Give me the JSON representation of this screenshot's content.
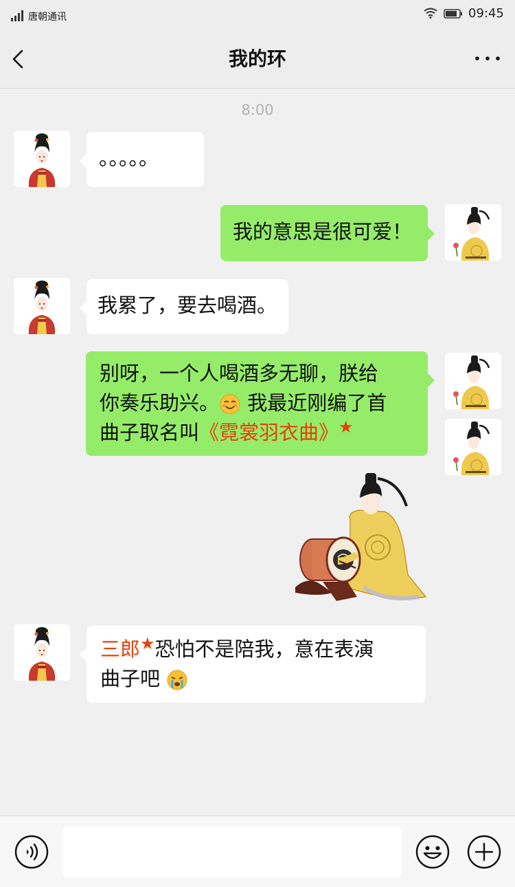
{
  "status_bar": {
    "carrier": "唐朝通讯",
    "time": "09:45"
  },
  "header": {
    "title": "我的环"
  },
  "chat": {
    "timestamp": "8:00",
    "messages": [
      {
        "sender": "consort",
        "text": "。。。。。"
      },
      {
        "sender": "emperor",
        "text": "我的意思是很可爱！"
      },
      {
        "sender": "consort",
        "text": "我累了，要去喝酒。"
      },
      {
        "sender": "emperor",
        "line1": "别呀，一个人喝酒多无聊，朕给",
        "line2a": "你奏乐助兴。",
        "line2b": "我最近刚编了首",
        "line3a": "曲子取名叫",
        "song_title": "《霓裳羽衣曲》",
        "star": "★",
        "emoji": "blush-smile-emoji"
      },
      {
        "sender": "emperor",
        "type": "sticker",
        "sticker": "emperor-playing-drum-sticker"
      },
      {
        "sender": "consort",
        "name_mention": "三郎",
        "star": "★",
        "line1": "恐怕不是陪我，意在表演",
        "line2": "曲子吧",
        "emoji": "crying-emoji"
      }
    ]
  },
  "input_bar": {
    "placeholder": "",
    "icons": [
      "voice-icon",
      "emoji-icon",
      "plus-icon"
    ]
  },
  "colors": {
    "outgoing_bubble": "#95ec69",
    "incoming_bubble": "#ffffff",
    "highlight": "#e8410a",
    "background": "#f0f0f0"
  }
}
